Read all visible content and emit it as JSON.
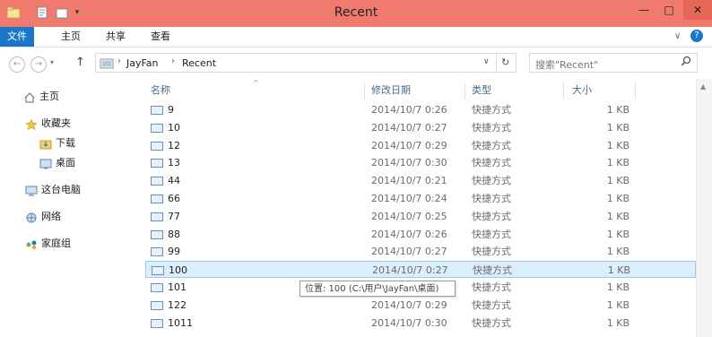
{
  "window": {
    "title": "Recent",
    "controls": {
      "minimize": "—",
      "maximize": "□",
      "close": "✕"
    }
  },
  "ribbon": {
    "tabs": [
      {
        "label": "文件"
      },
      {
        "label": "主页"
      },
      {
        "label": "共享"
      },
      {
        "label": "查看"
      }
    ],
    "help_icon": "?"
  },
  "address": {
    "back_icon": "←",
    "forward_icon": "→",
    "up_icon": "↑",
    "crumbs": [
      "JayFan",
      "Recent"
    ],
    "search_placeholder": "搜索\"Recent\""
  },
  "nav": {
    "items": [
      {
        "label": "主页",
        "icon": "home-icon"
      },
      {
        "label": "收藏夹",
        "icon": "star-icon"
      },
      {
        "label": "下载",
        "icon": "download-folder-icon"
      },
      {
        "label": "桌面",
        "icon": "desktop-icon"
      },
      {
        "label": "这台电脑",
        "icon": "computer-icon"
      },
      {
        "label": "网络",
        "icon": "network-icon"
      },
      {
        "label": "家庭组",
        "icon": "homegroup-icon"
      }
    ]
  },
  "columns": {
    "name": "名称",
    "date": "修改日期",
    "type": "类型",
    "size": "大小"
  },
  "files": [
    {
      "name": "9",
      "date": "2014/10/7 0:26",
      "type": "快捷方式",
      "size": "1 KB"
    },
    {
      "name": "10",
      "date": "2014/10/7 0:27",
      "type": "快捷方式",
      "size": "1 KB"
    },
    {
      "name": "12",
      "date": "2014/10/7 0:29",
      "type": "快捷方式",
      "size": "1 KB"
    },
    {
      "name": "13",
      "date": "2014/10/7 0:30",
      "type": "快捷方式",
      "size": "1 KB"
    },
    {
      "name": "44",
      "date": "2014/10/7 0:21",
      "type": "快捷方式",
      "size": "1 KB"
    },
    {
      "name": "66",
      "date": "2014/10/7 0:24",
      "type": "快捷方式",
      "size": "1 KB"
    },
    {
      "name": "77",
      "date": "2014/10/7 0:25",
      "type": "快捷方式",
      "size": "1 KB"
    },
    {
      "name": "88",
      "date": "2014/10/7 0:26",
      "type": "快捷方式",
      "size": "1 KB"
    },
    {
      "name": "99",
      "date": "2014/10/7 0:27",
      "type": "快捷方式",
      "size": "1 KB"
    },
    {
      "name": "100",
      "date": "2014/10/7 0:27",
      "type": "快捷方式",
      "size": "1 KB"
    },
    {
      "name": "101",
      "date": "",
      "type": "快捷方式",
      "size": "1 KB"
    },
    {
      "name": "122",
      "date": "2014/10/7 0:29",
      "type": "快捷方式",
      "size": "1 KB"
    },
    {
      "name": "1011",
      "date": "2014/10/7 0:30",
      "type": "快捷方式",
      "size": "1 KB"
    }
  ],
  "tooltip": "位置: 100 (C:\\用户\\JayFan\\桌面)",
  "colors": {
    "titlebar": "#f07a6e",
    "file_tab": "#1c76c8",
    "selection": "#dbeefc"
  }
}
